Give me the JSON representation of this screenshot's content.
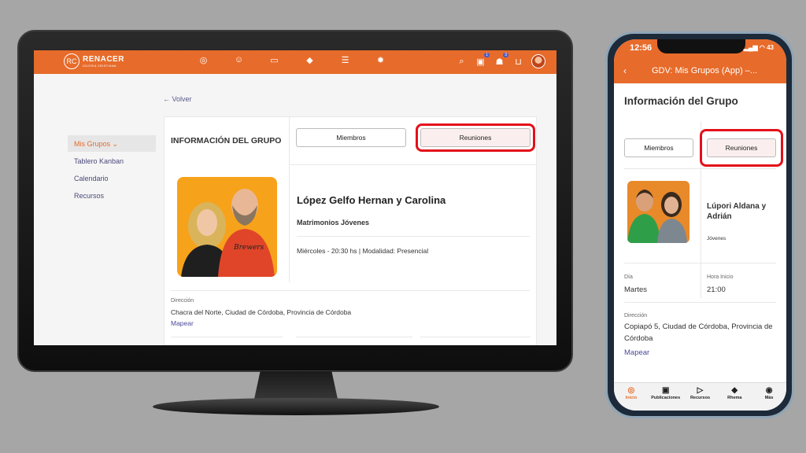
{
  "desktop": {
    "logo": {
      "mark": "RC",
      "name": "RENACER",
      "sub": "IGLESIA CRISTIANA"
    },
    "nav_icons": [
      "circle-icon",
      "group-icon",
      "video-icon",
      "graduation-cap-icon",
      "menu-circle-icon",
      "gear-icon"
    ],
    "nav_glyphs": [
      "◎",
      "☺",
      "▭",
      "◆",
      "☰",
      "✹"
    ],
    "right": {
      "search": "⌕",
      "inbox": "▣",
      "inbox_badge": "1",
      "chat": "☗",
      "chat_badge": "3",
      "cart": "⊔"
    },
    "back_label": "← Volver",
    "sidebar": [
      {
        "label": "Mis Grupos ⌄",
        "active": true
      },
      {
        "label": "Tablero Kanban"
      },
      {
        "label": "Calendario"
      },
      {
        "label": "Recursos"
      }
    ],
    "card": {
      "title": "INFORMACIÓN DEL GRUPO",
      "members_button": "Miembros",
      "meetings_button": "Reuniones",
      "leaders": "López Gelfo Hernan y Carolina",
      "group_name": "Matrimonios Jóvenes",
      "schedule": "Miércoles - 20:30 hs | Modalidad: Presencial",
      "address_label": "Dirección",
      "address": "Chacra del Norte, Ciudad de Córdoba, Provincia de Córdoba",
      "map_link": "Mapear"
    }
  },
  "phone": {
    "status": {
      "time": "12:56",
      "icons": "▂▄▆ ◠ 43"
    },
    "bar": {
      "back": "‹",
      "title": "GDV: Mis Grupos (App) –..."
    },
    "heading": "Información del Grupo",
    "members_button": "Miembros",
    "meetings_button": "Reuniones",
    "leaders": "Lúpori Aldana y Adrián",
    "group_name": "Jóvenes",
    "day_label": "Día",
    "day_value": "Martes",
    "start_label": "Hora Inicio",
    "start_value": "21:00",
    "address_label": "Dirección",
    "address": "Copiapó 5, Ciudad de Córdoba, Provincia de Córdoba",
    "map_link": "Mapear",
    "tabs": [
      {
        "icon": "◎",
        "label": "Inicio",
        "active": true
      },
      {
        "icon": "▣",
        "label": "Publicaciones"
      },
      {
        "icon": "▷",
        "label": "Recursos"
      },
      {
        "icon": "◆",
        "label": "Rhema"
      },
      {
        "icon": "◉",
        "label": "Más"
      }
    ]
  },
  "colors": {
    "brand": "#e76b2a",
    "highlight": "#e4101a",
    "link": "#4a4a9a"
  }
}
